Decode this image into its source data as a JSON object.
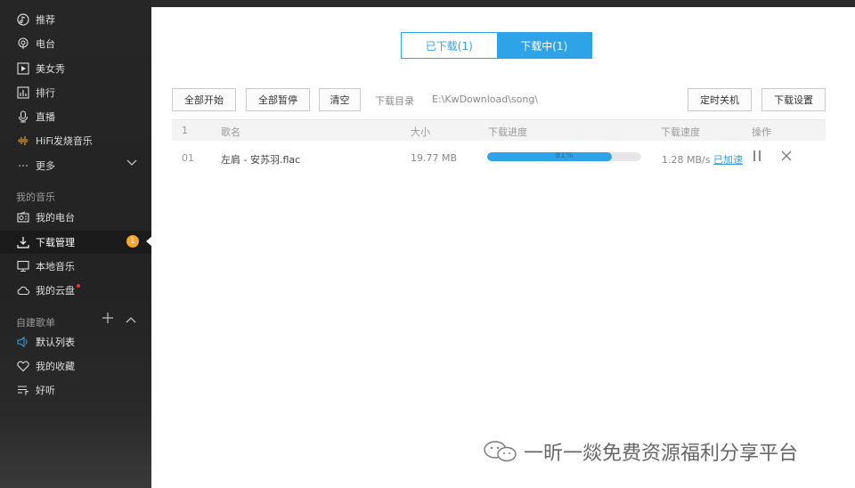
{
  "sidebar": {
    "items": [
      {
        "label": "推荐",
        "icon": "music-note-circle-icon"
      },
      {
        "label": "电台",
        "icon": "radio-icon"
      },
      {
        "label": "美女秀",
        "icon": "video-play-icon"
      },
      {
        "label": "排行",
        "icon": "bar-chart-icon"
      },
      {
        "label": "直播",
        "icon": "microphone-icon"
      },
      {
        "label": "HiFi发烧音乐",
        "icon": "waveform-icon"
      },
      {
        "label": "更多",
        "icon": "more-dots-icon"
      }
    ],
    "my_music_title": "我的音乐",
    "my_music": [
      {
        "label": "我的电台",
        "icon": "radio-box-icon"
      },
      {
        "label": "下载管理",
        "icon": "download-icon",
        "badge": "1",
        "active": true
      },
      {
        "label": "本地音乐",
        "icon": "monitor-icon"
      },
      {
        "label": "我的云盘",
        "icon": "cloud-icon"
      }
    ],
    "playlists_title": "自建歌单",
    "playlists": [
      {
        "label": "默认列表",
        "icon": "speaker-icon"
      },
      {
        "label": "我的收藏",
        "icon": "heart-icon"
      },
      {
        "label": "好听",
        "icon": "playlist-icon"
      }
    ]
  },
  "tabs": [
    {
      "label": "已下载(1)",
      "active": false
    },
    {
      "label": "下载中(1)",
      "active": true
    }
  ],
  "toolbar": {
    "start_all": "全部开始",
    "pause_all": "全部暂停",
    "clear": "清空",
    "dir_label": "下载目录",
    "dir_path": "E:\\KwDownload\\song\\",
    "shutdown_timer": "定时关机",
    "download_settings": "下载设置"
  },
  "table": {
    "headers": [
      "1",
      "歌名",
      "大小",
      "下载进度",
      "下载速度",
      "操作"
    ],
    "rows": [
      {
        "index": "01",
        "name": "左肩 - 安苏羽.flac",
        "size": "19.77 MB",
        "progress": 81,
        "progress_text": "81%",
        "speed": "1.28 MB/s",
        "accelerated": "已加速"
      }
    ]
  },
  "colors": {
    "accent": "#2ea3e8",
    "sidebar_bg": "#262626",
    "badge": "#f2a531"
  },
  "watermark": "一昕一燚免费资源福利分享平台"
}
